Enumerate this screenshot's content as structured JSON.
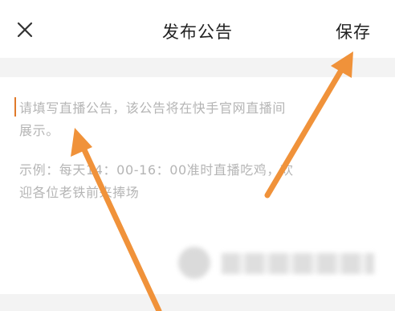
{
  "header": {
    "title": "发布公告",
    "save_label": "保存",
    "close_icon": "close-icon"
  },
  "editor": {
    "placeholder_line1": "请填写直播公告，该公告将在快手官网直播间",
    "placeholder_line2": "展示。",
    "example_line1": "示例：每天14：00-16：00准时直播吃鸡，欢",
    "example_line2": "迎各位老铁前来捧场"
  },
  "colors": {
    "arrow": "#f0923a",
    "caret": "#e07a2a",
    "placeholder_text": "#b5b5b5",
    "header_text": "#222222",
    "divider": "#f3f3f3"
  }
}
